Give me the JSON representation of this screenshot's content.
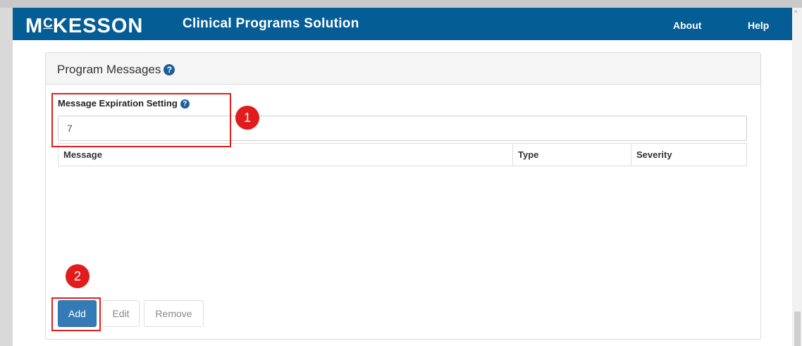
{
  "header": {
    "logo_prefix": "M",
    "logo_c": "C",
    "logo_rest": "KESSON",
    "app_title": "Clinical Programs Solution",
    "nav": {
      "about": "About",
      "help": "Help"
    },
    "colors": {
      "bar": "#055d96"
    }
  },
  "panel": {
    "title": "Program Messages",
    "help_icon": "question-circle-icon"
  },
  "expiration": {
    "label": "Message Expiration Setting",
    "value": "7"
  },
  "table": {
    "columns": [
      "Message",
      "Type",
      "Severity"
    ],
    "rows": []
  },
  "buttons": {
    "add": "Add",
    "edit": "Edit",
    "remove": "Remove"
  },
  "annotations": {
    "step1": "1",
    "step2": "2",
    "color": "#e01c1c"
  }
}
